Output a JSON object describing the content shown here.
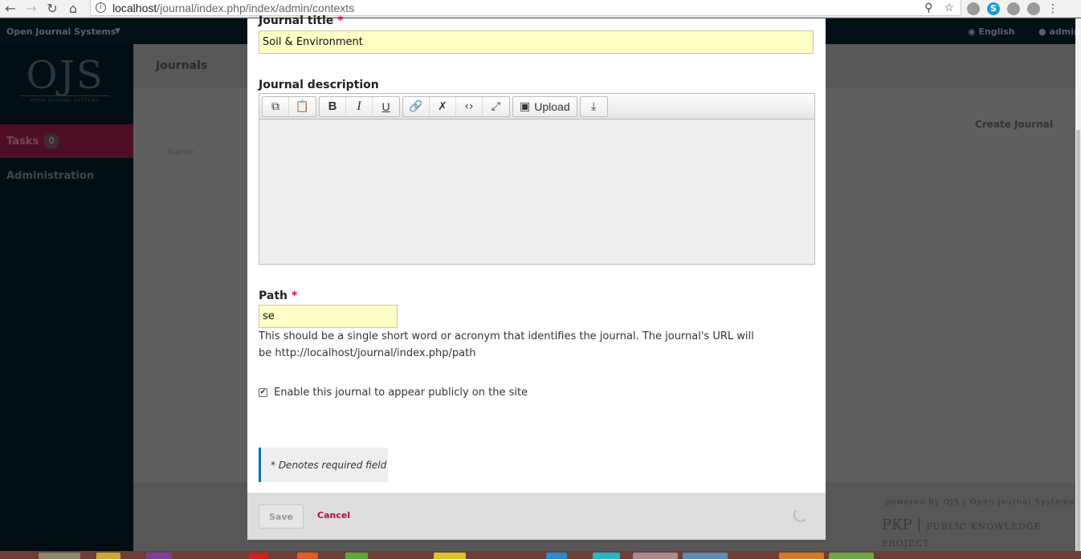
{
  "browser": {
    "url_host": "localhost",
    "url_path": "/journal/index.php/index/admin/contexts"
  },
  "app": {
    "site_name": "Open Journal Systems",
    "language": "English",
    "user": "admin",
    "logo_text": "OJS",
    "logo_subtext": "OPEN JOURNAL SYSTEMS"
  },
  "sidebar": {
    "tasks_label": "Tasks",
    "tasks_count": "0",
    "administration_label": "Administration"
  },
  "page": {
    "title": "Journals",
    "create_journal": "Create Journal",
    "name_column": "Name"
  },
  "footer": {
    "powered_by": "powered by OJS | Open Journal Systems",
    "pkp": "PKP",
    "pkp_full": "PUBLIC KNOWLEDGE PROJECT"
  },
  "form": {
    "journal_title_label": "Journal title",
    "required_mark": "*",
    "journal_title_value": "Soil & Environment",
    "journal_description_label": "Journal description",
    "upload_label": "Upload",
    "path_label": "Path",
    "path_value": "se",
    "path_help": "This should be a single short word or acronym that identifies the journal. The journal's URL will be http://localhost/journal/index.php/path",
    "enable_public_label": "Enable this journal to appear publicly on the site",
    "enable_public_checked": true,
    "required_note": "* Denotes required field",
    "save_label": "Save",
    "cancel_label": "Cancel"
  },
  "colors": {
    "accent": "#d00b6b",
    "input_bg": "#ffffc6",
    "note_border": "#0c6fa8"
  }
}
